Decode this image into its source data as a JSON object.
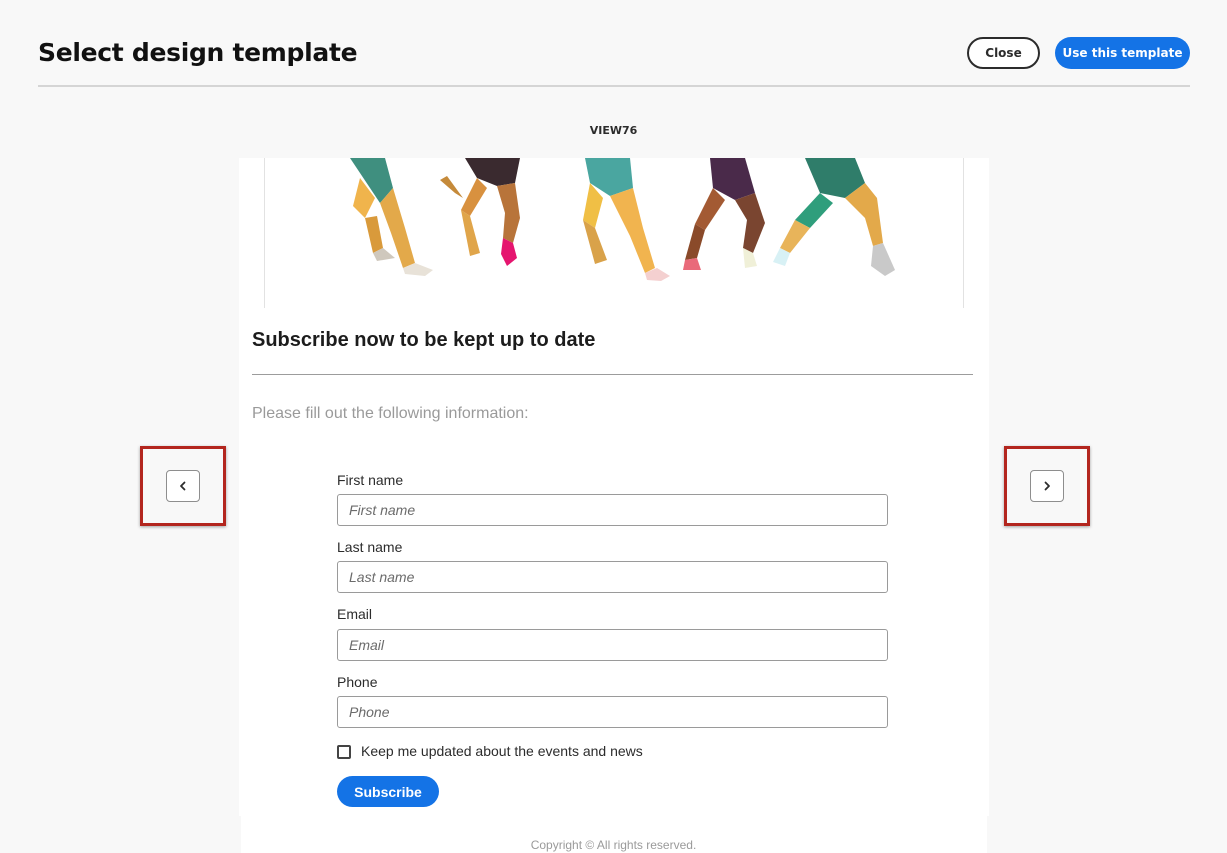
{
  "header": {
    "title": "Select design template",
    "close_label": "Close",
    "use_label": "Use this template"
  },
  "template": {
    "name": "VIEW76"
  },
  "navigation": {
    "prev_icon": "chevron-left-icon",
    "next_icon": "chevron-right-icon",
    "highlight_color": "#b3261e"
  },
  "form": {
    "title": "Subscribe now to be kept up to date",
    "intro": "Please fill out the following information:",
    "fields": [
      {
        "label": "First name",
        "placeholder": "First name"
      },
      {
        "label": "Last name",
        "placeholder": "Last name"
      },
      {
        "label": "Email",
        "placeholder": "Email"
      },
      {
        "label": "Phone",
        "placeholder": "Phone"
      }
    ],
    "checkbox_label": "Keep me updated about the events and news",
    "checkbox_checked": false,
    "submit_label": "Subscribe"
  },
  "footer": {
    "copyright": "Copyright ©  All rights reserved."
  },
  "colors": {
    "accent": "#1473e6",
    "background": "#f8f8f8"
  }
}
